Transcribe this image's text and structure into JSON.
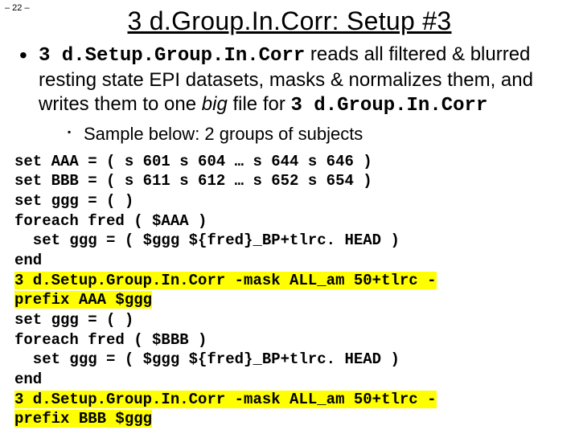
{
  "page_number": "– 22 –",
  "title": "3 d.Group.In.Corr: Setup #3",
  "bullet": {
    "prog1": "3 d.Setup.Group.In.Corr",
    "text1": " reads all filtered & blurred resting state EPI datasets, masks & normalizes them, and writes them to one ",
    "big": "big",
    "text2": " file for ",
    "prog2": "3 d.Group.In.Corr"
  },
  "subbullet": "Sample below: 2 groups of subjects",
  "code": [
    {
      "hl": false,
      "text": "set AAA = ( s 601 s 604 … s 644 s 646 )"
    },
    {
      "hl": false,
      "text": "set BBB = ( s 611 s 612 … s 652 s 654 )"
    },
    {
      "hl": false,
      "text": "set ggg = ( )"
    },
    {
      "hl": false,
      "text": "foreach fred ( $AAA )"
    },
    {
      "hl": false,
      "text": "  set ggg = ( $ggg ${fred}_BP+tlrc. HEAD )"
    },
    {
      "hl": false,
      "text": "end"
    },
    {
      "hl": true,
      "text": "3 d.Setup.Group.In.Corr -mask ALL_am 50+tlrc -prefix AAA $ggg"
    },
    {
      "hl": false,
      "text": "set ggg = ( )"
    },
    {
      "hl": false,
      "text": "foreach fred ( $BBB )"
    },
    {
      "hl": false,
      "text": "  set ggg = ( $ggg ${fred}_BP+tlrc. HEAD )"
    },
    {
      "hl": false,
      "text": "end"
    },
    {
      "hl": true,
      "text": "3 d.Setup.Group.In.Corr -mask ALL_am 50+tlrc -prefix BBB $ggg"
    }
  ]
}
